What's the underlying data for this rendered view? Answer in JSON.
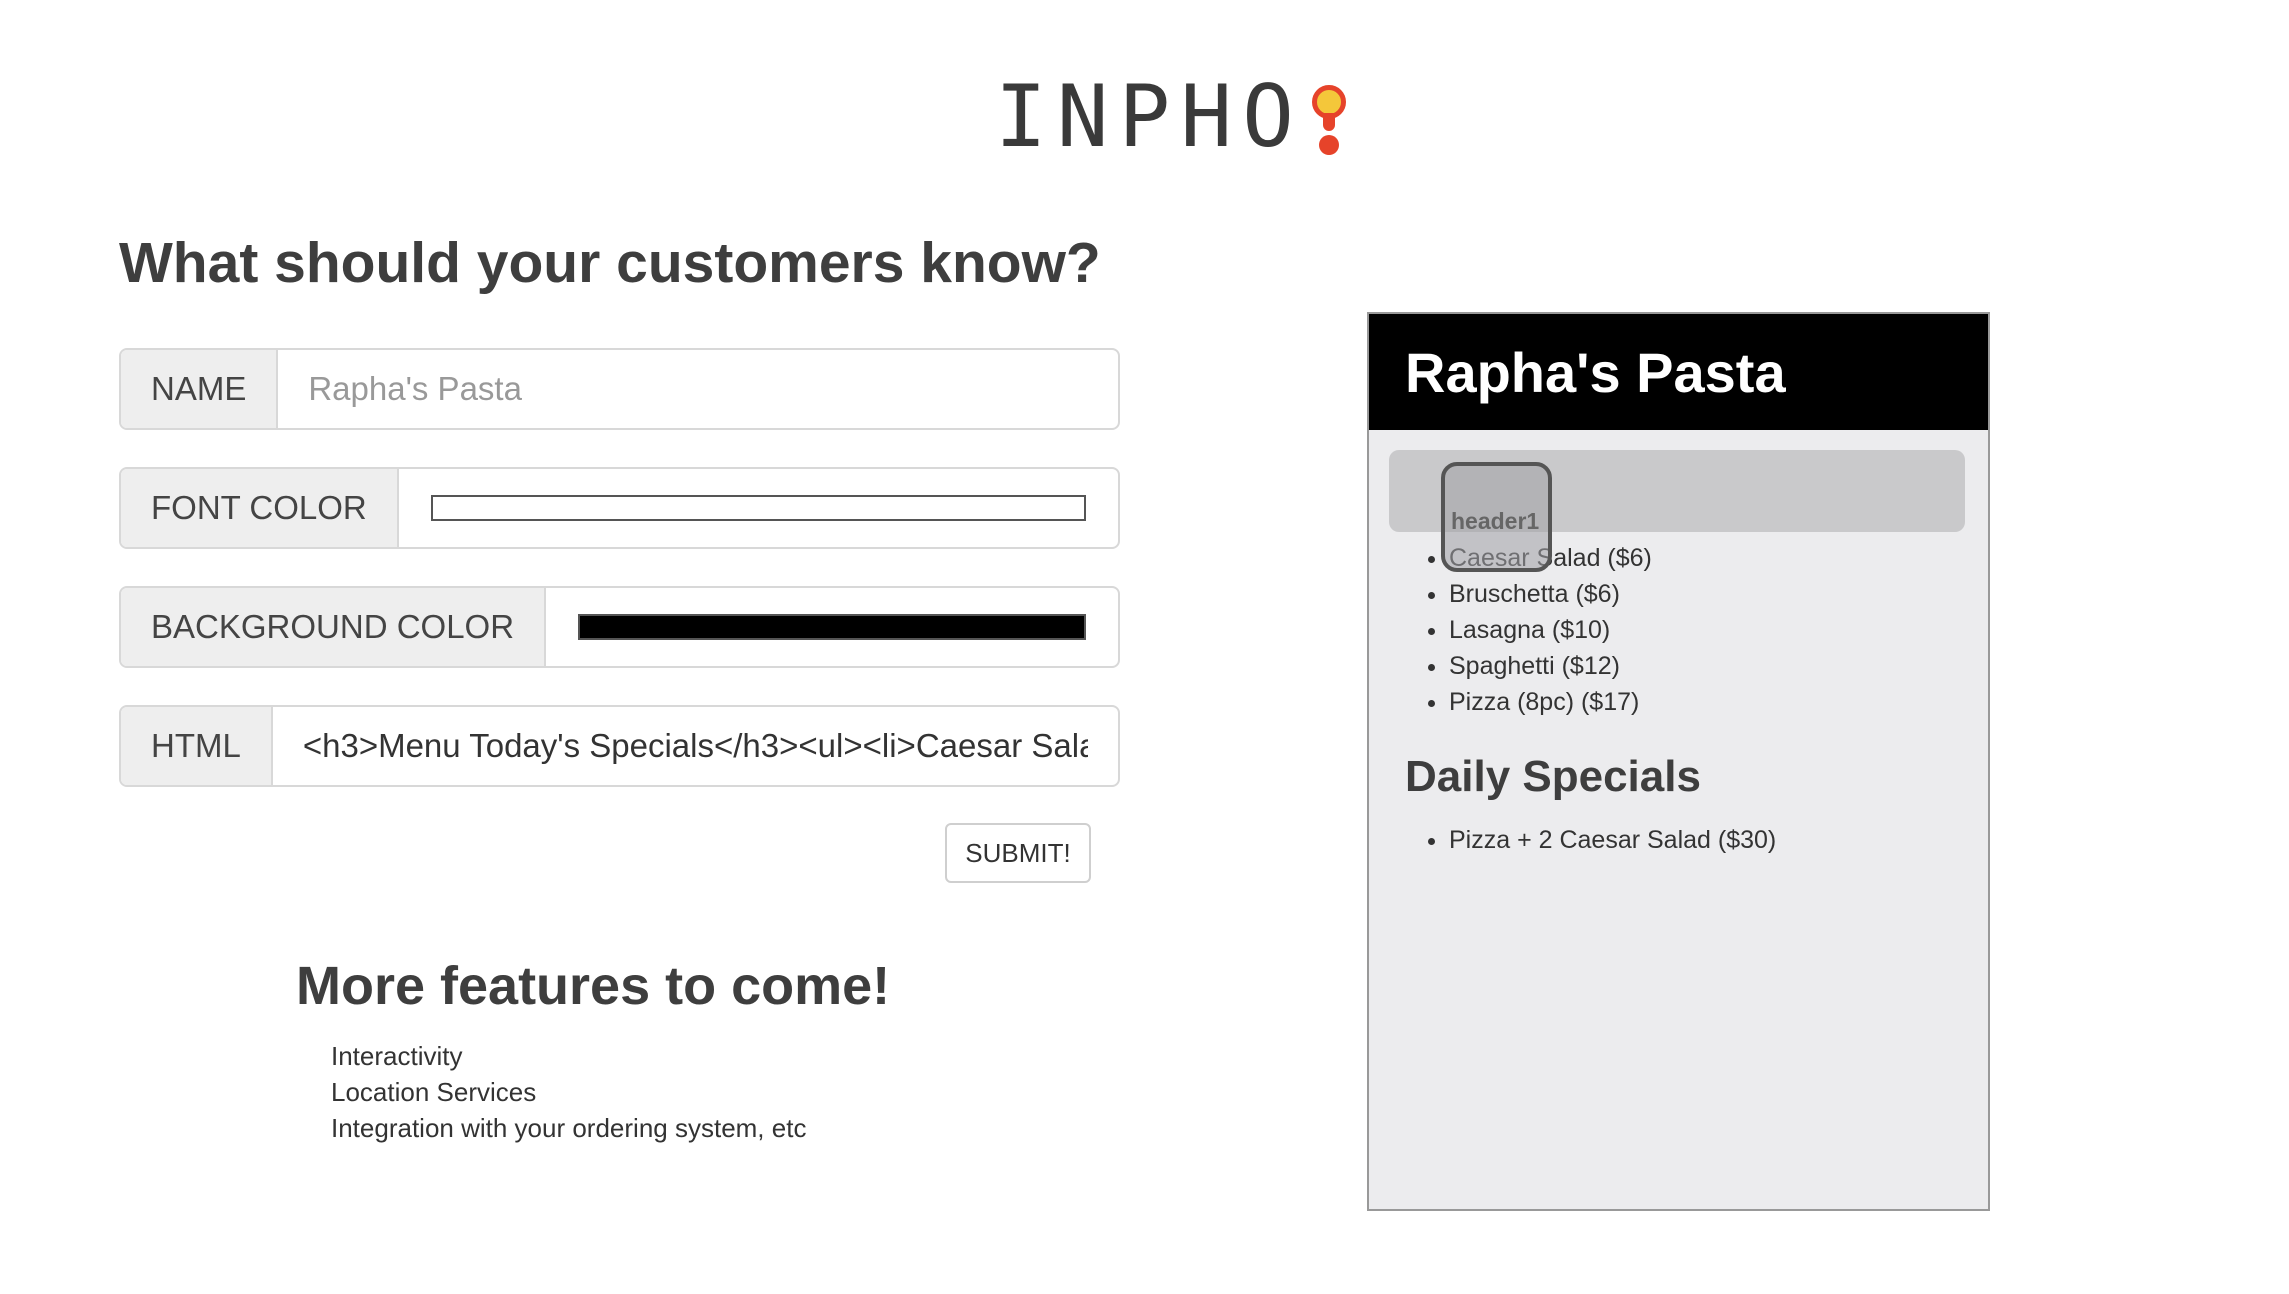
{
  "logo": {
    "text": "INPHO"
  },
  "form": {
    "title": "What should your customers know?",
    "name": {
      "label": "NAME",
      "placeholder": "Rapha's Pasta"
    },
    "font_color": {
      "label": "FONT COLOR",
      "value": "#ffffff"
    },
    "background_color": {
      "label": "BACKGROUND COLOR",
      "value": "#000000"
    },
    "html": {
      "label": "HTML",
      "value": "<h3>Menu Today's Specials</h3><ul><li>Caesar Sala"
    },
    "submit_label": "SUBMIT!"
  },
  "features": {
    "title": "More features to come!",
    "items": [
      "Interactivity",
      "Location Services",
      "Integration with your ordering system, etc"
    ]
  },
  "preview": {
    "title": "Rapha's Pasta",
    "drag_chip_label": "header1",
    "menu_items": [
      "Caesar Salad ($6)",
      "Bruschetta ($6)",
      "Lasagna ($10)",
      "Spaghetti ($12)",
      "Pizza (8pc) ($17)"
    ],
    "specials_title": "Daily Specials",
    "specials_items": [
      "Pizza + 2 Caesar Salad ($30)"
    ]
  },
  "colors": {
    "logo_accent_red": "#e6432a",
    "logo_accent_yellow": "#f4c73a",
    "preview_header_bg": "#000000",
    "preview_body_bg": "#ececee"
  }
}
